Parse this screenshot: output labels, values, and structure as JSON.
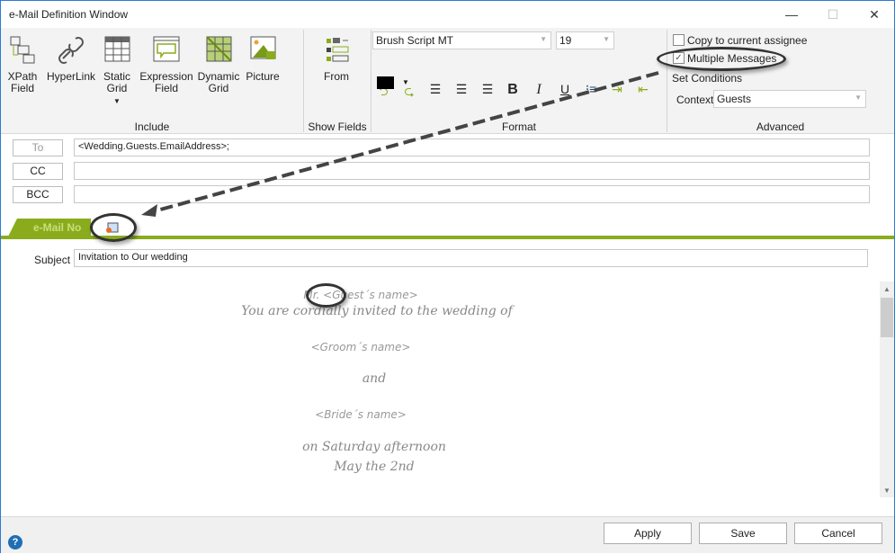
{
  "window": {
    "title": "e-Mail Definition Window",
    "minimize": "—",
    "maximize": "☐",
    "close": "✕"
  },
  "ribbon": {
    "include": {
      "label": "Include",
      "buttons": [
        {
          "label1": "XPath",
          "label2": "Field"
        },
        {
          "label1": "HyperLink",
          "label2": ""
        },
        {
          "label1": "Static",
          "label2": "Grid"
        },
        {
          "label1": "Expression",
          "label2": "Field"
        },
        {
          "label1": "Dynamic",
          "label2": "Grid"
        },
        {
          "label1": "Picture",
          "label2": ""
        }
      ]
    },
    "show_fields": {
      "label": "Show Fields",
      "from": "From"
    },
    "format": {
      "label": "Format",
      "font": "Brush Script MT",
      "size": "19",
      "bold": "B",
      "italic": "I",
      "underline": "U",
      "color": "#000000"
    },
    "advanced": {
      "label": "Advanced",
      "copy_assignee": "Copy to current assignee",
      "copy_checked": false,
      "multiple_messages": "Multiple Messages",
      "multiple_checked": true,
      "set_conditions": "Set Conditions",
      "context_label": "Context",
      "context_value": "Guests"
    }
  },
  "recipients": {
    "to_label": "To",
    "to_value": "<Wedding.Guests.EmailAddress>;",
    "cc_label": "CC",
    "cc_value": "",
    "bcc_label": "BCC",
    "bcc_value": ""
  },
  "tabs": {
    "email": "e-Mail No"
  },
  "subject": {
    "label": "Subject",
    "value": "Invitation to Our wedding"
  },
  "body": {
    "lines": [
      "Mr. <Guest´s name>",
      "You are cordially invited to the wedding of",
      "<Groom´s name>",
      "and",
      "<Bride´s name>",
      "on Saturday afternoon",
      "May the 2nd"
    ]
  },
  "footer": {
    "apply": "Apply",
    "save": "Save",
    "cancel": "Cancel",
    "help": "?"
  },
  "colors": {
    "accent": "#8aac1c",
    "border": "#2b7bd4"
  }
}
